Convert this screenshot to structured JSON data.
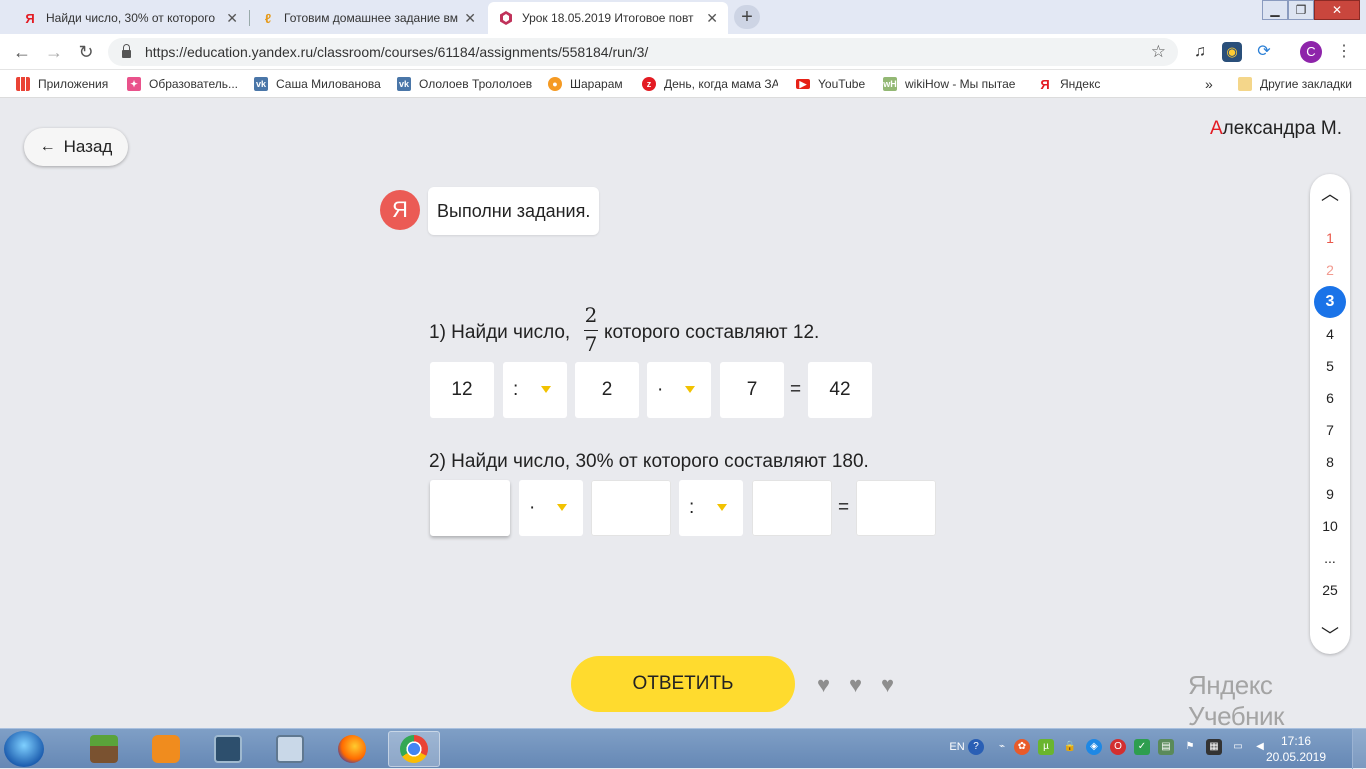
{
  "browser": {
    "tabs": [
      {
        "title": "Найди число, 30% от которого",
        "icon": "yandex-icon"
      },
      {
        "title": "Готовим домашнее задание вм",
        "icon": "orange-logo-icon"
      },
      {
        "title": "Урок 18.05.2019 Итоговое повт",
        "icon": "hexagon-icon"
      }
    ],
    "new_tab": "+",
    "url": "https://education.yandex.ru/classroom/courses/61184/assignments/558184/run/3/",
    "profile_initial": "С",
    "bookmarks": [
      {
        "label": "Приложения",
        "icon": "apps-grid-icon"
      },
      {
        "label": "Образователь...",
        "icon": "edu-icon"
      },
      {
        "label": "Саша Милованова",
        "icon": "vk-icon"
      },
      {
        "label": "Ололоев Трололоев",
        "icon": "vk-icon"
      },
      {
        "label": "Шарарам",
        "icon": "shararam-icon"
      },
      {
        "label": "День, когда мама ЗА",
        "icon": "zen-icon"
      },
      {
        "label": "YouTube",
        "icon": "youtube-icon"
      },
      {
        "label": "wikiHow - Мы пытае",
        "icon": "wikihow-icon"
      },
      {
        "label": "Яндекс",
        "icon": "yandex-icon"
      }
    ],
    "more_bookmarks": "»",
    "other_bookmarks": "Другие закладки"
  },
  "page": {
    "back_label": "Назад",
    "user_first_letter": "А",
    "user_rest": "лександра М.",
    "avatar_letter": "Я",
    "bubble_text": "Выполни задания.",
    "task1": {
      "text_before": "1) Найди число,",
      "frac_num": "2",
      "frac_den": "7",
      "text_after": "которого составляют 12.",
      "cells": [
        "12",
        ":",
        "2",
        "·",
        "7"
      ],
      "equals": "=",
      "result": "42"
    },
    "task2": {
      "text": "2) Найди число, 30% от которого составляют 180.",
      "cells": [
        "",
        "·",
        "",
        ":",
        ""
      ],
      "equals": "=",
      "result": ""
    },
    "pager": {
      "items": [
        "1",
        "2",
        "3",
        "4",
        "5",
        "6",
        "7",
        "8",
        "9",
        "10",
        "...",
        "25"
      ],
      "current": "3"
    },
    "answer_label": "ОТВЕТИТЬ",
    "lives": 3,
    "brand": "Яндекс Учебник"
  },
  "taskbar": {
    "lang": "EN",
    "time": "17:16",
    "date": "20.05.2019"
  },
  "colors": {
    "accent_yellow": "#ffdb2e",
    "pager_current": "#1a73e8",
    "yandex_red": "#e31b23",
    "avatar_red": "#eb5b55"
  }
}
